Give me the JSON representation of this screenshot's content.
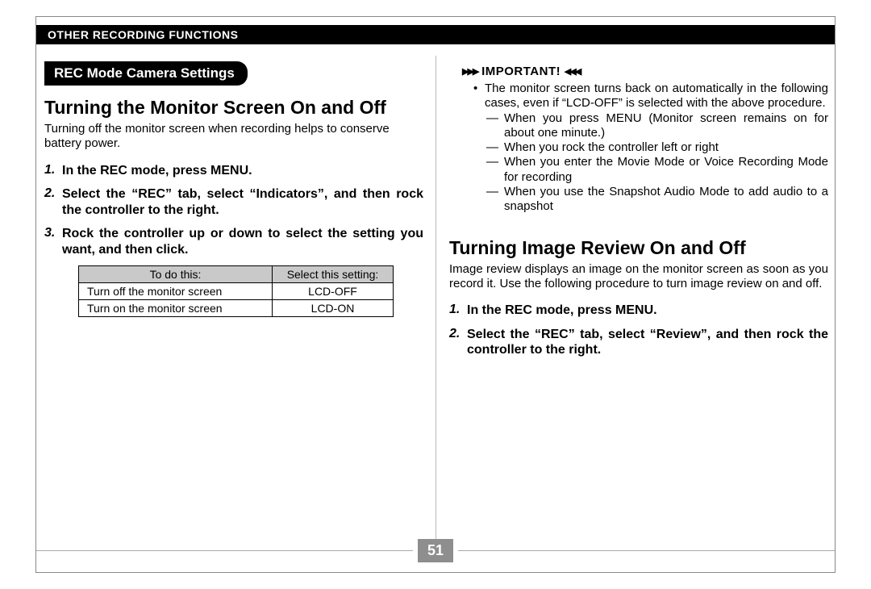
{
  "header": "OTHER RECORDING FUNCTIONS",
  "page_number": "51",
  "left": {
    "pill": "REC Mode Camera Settings",
    "h2": "Turning the Monitor Screen On and Off",
    "intro": "Turning off the monitor screen when recording helps to conserve battery power.",
    "steps": [
      {
        "n": "1.",
        "t": "In the REC mode, press MENU."
      },
      {
        "n": "2.",
        "t": "Select the “REC” tab, select “Indicators”, and then rock the controller to the right."
      },
      {
        "n": "3.",
        "t": "Rock the controller up or down to select the setting you want, and then click."
      }
    ],
    "table": {
      "headers": [
        "To do this:",
        "Select this setting:"
      ],
      "rows": [
        [
          "Turn off the monitor screen",
          "LCD-OFF"
        ],
        [
          "Turn on the monitor screen",
          "LCD-ON"
        ]
      ]
    }
  },
  "right": {
    "important": "IMPORTANT!",
    "bullet": "The monitor screen turns back on automatically in the following cases, even if “LCD-OFF” is selected with the above procedure.",
    "dashes": [
      "When you press MENU (Monitor screen remains on for about one minute.)",
      "When you rock the controller left or right",
      "When you enter the Movie Mode or Voice Recording Mode for recording",
      "When you use the Snapshot Audio Mode to add audio to a snapshot"
    ],
    "h2": "Turning Image Review On and Off",
    "intro": "Image review displays an image on the monitor screen as soon as you record it. Use the following procedure to turn image review on and off.",
    "steps": [
      {
        "n": "1.",
        "t": "In the REC mode, press MENU."
      },
      {
        "n": "2.",
        "t": "Select the “REC” tab, select “Review”, and then rock the controller to the right."
      }
    ]
  }
}
